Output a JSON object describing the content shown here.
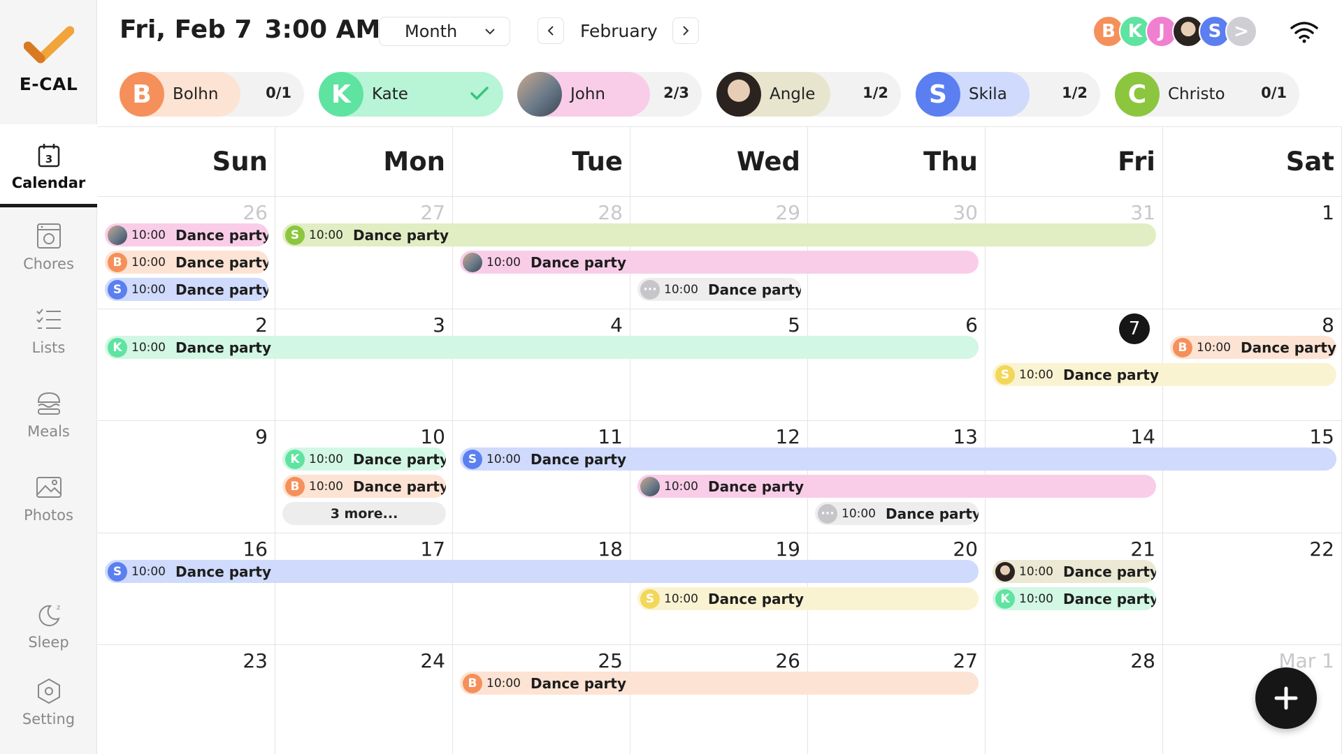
{
  "app": {
    "name": "E-CAL",
    "colors": {
      "brand": "#f08a3a",
      "bolhn": "#f5905a",
      "kate": "#5fe3a0",
      "john_bg": "#f9cde8",
      "angle_bg": "#e8e5cf",
      "skila": "#5b7ff0",
      "christo": "#8cc63f",
      "today": "#161616"
    }
  },
  "sidebar": {
    "items": [
      {
        "label": "Calendar",
        "icon": "calendar-icon"
      },
      {
        "label": "Chores",
        "icon": "washer-icon"
      },
      {
        "label": "Lists",
        "icon": "checklist-icon"
      },
      {
        "label": "Meals",
        "icon": "burger-icon"
      },
      {
        "label": "Photos",
        "icon": "photo-icon"
      },
      {
        "label": "Sleep",
        "icon": "moon-icon"
      },
      {
        "label": "Setting",
        "icon": "hex-settings-icon"
      }
    ]
  },
  "header": {
    "date": "Fri, Feb 7",
    "time": "3:00 AM",
    "view": "Month",
    "month": "February",
    "prev_icon": "chevron-left-icon",
    "next_icon": "chevron-right-icon",
    "avatars": [
      "B",
      "K",
      "J",
      "",
      "S",
      ">"
    ]
  },
  "members": [
    {
      "letter": "B",
      "name": "Bolhn",
      "count": "0/1"
    },
    {
      "letter": "K",
      "name": "Kate",
      "count": "✓"
    },
    {
      "letter": "",
      "name": "John",
      "count": "2/3"
    },
    {
      "letter": "",
      "name": "Angle",
      "count": "1/2"
    },
    {
      "letter": "S",
      "name": "Skila",
      "count": "1/2"
    },
    {
      "letter": "C",
      "name": "Christo",
      "count": "0/1"
    }
  ],
  "calendar": {
    "weekdays": [
      "Sun",
      "Mon",
      "Tue",
      "Wed",
      "Thu",
      "Fri",
      "Sat"
    ],
    "weeks": [
      [
        "26",
        "27",
        "28",
        "29",
        "30",
        "31",
        "1"
      ],
      [
        "2",
        "3",
        "4",
        "5",
        "6",
        "7",
        "8"
      ],
      [
        "9",
        "10",
        "11",
        "12",
        "13",
        "14",
        "15"
      ],
      [
        "16",
        "17",
        "18",
        "19",
        "20",
        "21",
        "22"
      ],
      [
        "23",
        "24",
        "25",
        "26",
        "27",
        "28",
        "Mar 1"
      ]
    ],
    "more_label": "3 more...",
    "event_time": "10:00",
    "event_title": "Dance party"
  },
  "fab_icon": "plus-icon"
}
